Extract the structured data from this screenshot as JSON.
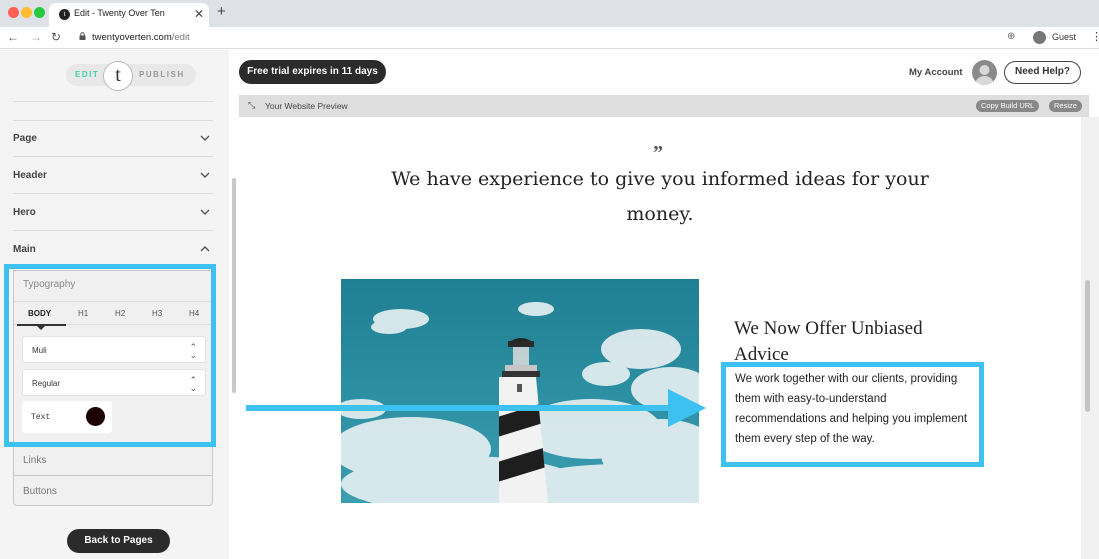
{
  "browser": {
    "tab_title": "Edit - Twenty Over Ten",
    "url_host": "twentyoverten.com",
    "url_path": "/edit",
    "profile_label": "Guest"
  },
  "editor": {
    "mode_edit": "EDIT",
    "mode_publish": "PUBLISH",
    "logo_letter": "t",
    "sections": [
      {
        "label": "Page"
      },
      {
        "label": "Header"
      },
      {
        "label": "Hero"
      },
      {
        "label": "Main"
      }
    ],
    "typography": {
      "title": "Typography",
      "tabs": [
        "BODY",
        "H1",
        "H2",
        "H3",
        "H4"
      ],
      "font_family": "Muli",
      "font_weight": "Regular",
      "color_label": "Text",
      "color_value": "#1c0004"
    },
    "sub_items": [
      "Links",
      "Buttons"
    ],
    "back_button": "Back to Pages"
  },
  "topbar": {
    "trial_text": "Free trial expires in 11 days",
    "account_label": "My Account",
    "help_button": "Need Help?"
  },
  "preview": {
    "title": "Your Website Preview",
    "copy_url_button": "Copy Build URL",
    "resize_button": "Resize",
    "quote_mark": "”",
    "quote": "We have experience to give you informed ideas for your money.",
    "offer_heading": "We Now Offer Unbiased Advice",
    "offer_body": "We work together with our clients, providing them with easy-to-understand recommendations and helping you implement them every step of the way."
  },
  "colors": {
    "accent": "#3dc1f0",
    "edit_green": "#3fd1a9",
    "dark_button": "#2b2b2b"
  }
}
